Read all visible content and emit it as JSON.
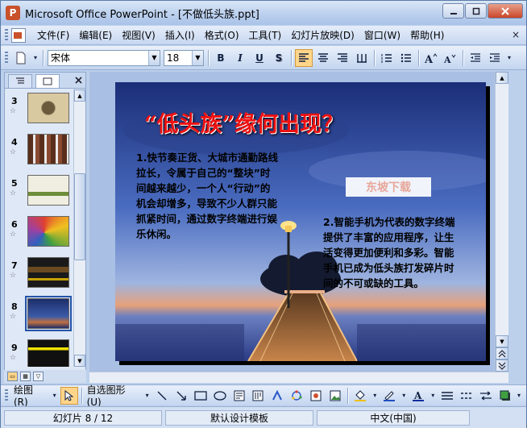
{
  "window": {
    "title": "Microsoft Office PowerPoint - [不做低头族.ppt]",
    "app_icon_label": "P"
  },
  "menubar": {
    "items": [
      "文件(F)",
      "编辑(E)",
      "视图(V)",
      "插入(I)",
      "格式(O)",
      "工具(T)",
      "幻灯片放映(D)",
      "窗口(W)",
      "帮助(H)"
    ],
    "close_doc": "×"
  },
  "toolbar": {
    "font_name": "宋体",
    "font_size": "18",
    "bold": "B",
    "italic": "I",
    "underline": "U",
    "shadow": "S"
  },
  "slide_panel": {
    "thumbnails": [
      {
        "number": "3",
        "colors": [
          "#d8c9a0",
          "#6b5a3c"
        ]
      },
      {
        "number": "4",
        "colors": [
          "#e8e8e8",
          "#5a2e1c"
        ]
      },
      {
        "number": "5",
        "colors": [
          "#f0eee0",
          "#6e8e3a"
        ]
      },
      {
        "number": "6",
        "colors": [
          "#1e3c78",
          "#e04030"
        ]
      },
      {
        "number": "7",
        "colors": [
          "#1a1a1a",
          "#c8a000"
        ]
      },
      {
        "number": "8",
        "colors": [
          "#1c2e6a",
          "#d03020"
        ],
        "selected": true
      },
      {
        "number": "9",
        "colors": [
          "#101010",
          "#f0e000"
        ]
      }
    ]
  },
  "slide": {
    "title": "“低头族”缘何出现？",
    "paragraph1": "1.快节奏正货、大城市通勤路线拉长，令属于自己的“整块”时间越来越少，一个人“行动”的机会却增多，导致不少人群只能抓紧时间，通过数字终端进行娱乐休闲。",
    "paragraph2": "2.智能手机为代表的数字终端提供了丰富的应用程序，让生活变得更加便利和多彩。智能手机已成为低头族打发碎片时间的不可或缺的工具。",
    "watermark": "东坡下载"
  },
  "drawbar": {
    "draw_label": "绘图(R)",
    "autoshape_label": "自选图形(U)"
  },
  "statusbar": {
    "slide_position": "幻灯片 8 / 12",
    "template": "默认设计模板",
    "language": "中文(中国)"
  }
}
